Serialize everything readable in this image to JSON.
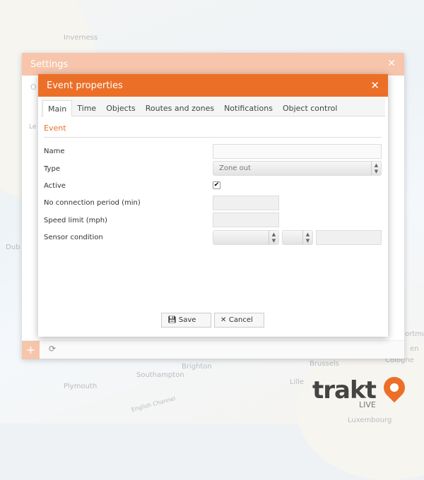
{
  "map": {
    "labels": [
      "Inverness",
      "Dub",
      "Brighton",
      "Southampton",
      "Plymouth",
      "English Channel",
      "Brussels",
      "Lille",
      "Cologne",
      "Luxembourg",
      "ortmu",
      "en"
    ]
  },
  "settings": {
    "title": "Settings",
    "close": "✕",
    "tab_partial": "O",
    "text_partial": "Le",
    "add": "+",
    "refresh": "⟳"
  },
  "dialog": {
    "title": "Event properties",
    "close": "✕",
    "tabs": [
      "Main",
      "Time",
      "Objects",
      "Routes and zones",
      "Notifications",
      "Object control"
    ],
    "section": "Event",
    "fields": {
      "name_label": "Name",
      "name_value": "",
      "type_label": "Type",
      "type_value": "Zone out",
      "active_label": "Active",
      "active_checked": true,
      "noconn_label": "No connection period (min)",
      "speed_label": "Speed limit (mph)",
      "sensor_label": "Sensor condition"
    },
    "save": "Save",
    "cancel": "Cancel"
  },
  "logo": {
    "text": "trakt",
    "sub": "LIVE"
  },
  "colors": {
    "accent": "#ec6f28",
    "accent_faded": "#f6c5ab"
  }
}
